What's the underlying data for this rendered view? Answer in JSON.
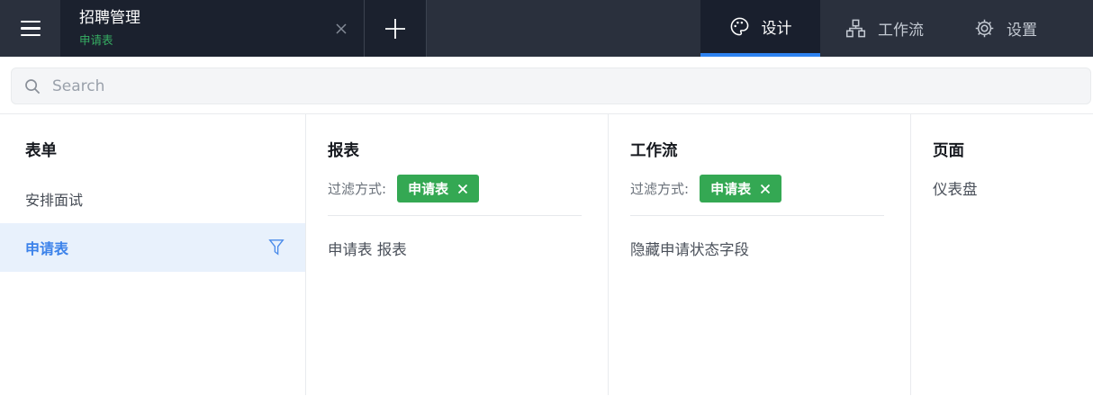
{
  "topbar": {
    "tab": {
      "title": "招聘管理",
      "subtitle": "申请表"
    },
    "nav": [
      {
        "label": "设计",
        "active": true
      },
      {
        "label": "工作流",
        "active": false
      },
      {
        "label": "设置",
        "active": false
      }
    ]
  },
  "search": {
    "placeholder": "Search"
  },
  "columns": [
    {
      "title": "表单",
      "items": [
        {
          "label": "安排面试",
          "selected": false
        },
        {
          "label": "申请表",
          "selected": true
        }
      ]
    },
    {
      "title": "报表",
      "filter_label": "过滤方式:",
      "filter_tag": "申请表",
      "items": [
        {
          "label": "申请表 报表"
        }
      ]
    },
    {
      "title": "工作流",
      "filter_label": "过滤方式:",
      "filter_tag": "申请表",
      "items": [
        {
          "label": "隐藏申请状态字段"
        }
      ]
    },
    {
      "title": "页面",
      "items": [
        {
          "label": "仪表盘"
        }
      ]
    }
  ],
  "icons": {
    "menu": "hamburger-icon",
    "tab_close": "close-icon",
    "add_tab": "plus-icon",
    "design": "palette-icon",
    "workflow": "sitemap-icon",
    "settings": "gear-icon",
    "search": "magnifier-icon",
    "selected_form": "filter-funnel-icon",
    "tag_remove": "close-icon"
  },
  "colors": {
    "topbar_bg": "#2a303d",
    "topbar_dark": "#1b212e",
    "active_tab_underline": "#2e82f0",
    "tab_subtitle_green": "#36ae63",
    "tag_green": "#34a853",
    "selected_row_bg": "#e8f1fc",
    "selected_row_text": "#3b82ea",
    "divider": "#e9ebee"
  }
}
